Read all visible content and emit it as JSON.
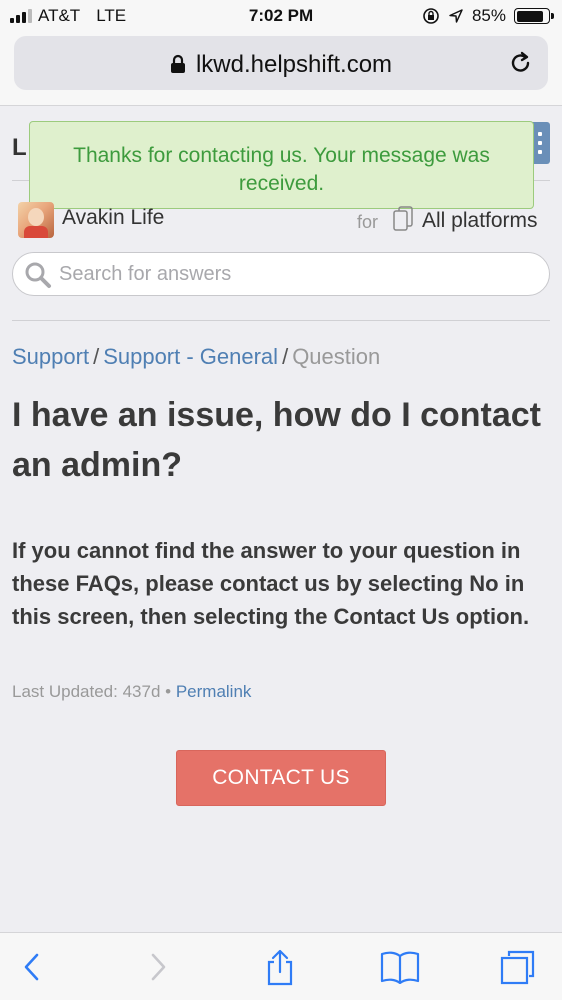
{
  "status_bar": {
    "carrier": "AT&T",
    "network": "LTE",
    "time": "7:02 PM",
    "battery_percent": "85%",
    "battery_level": 0.85
  },
  "browser": {
    "url": "lkwd.helpshift.com"
  },
  "site": {
    "logo_letter": "L"
  },
  "toast": {
    "message": "Thanks for contacting us. Your message was received."
  },
  "app": {
    "name": "Avakin Life",
    "for_label": "for",
    "platform": "All platforms"
  },
  "search": {
    "placeholder": "Search for answers"
  },
  "breadcrumb": {
    "items": [
      "Support",
      "Support - General"
    ],
    "separator": "/",
    "current": "Question"
  },
  "faq": {
    "title": "I have an issue, how do I contact an admin?",
    "body": "If you cannot find the answer to your question in these FAQs, please contact us by selecting No in this screen, then selecting the Contact Us option.",
    "last_updated_label": "Last Updated: 437d",
    "bullet": "•",
    "permalink": "Permalink"
  },
  "contact_button": {
    "label": "CONTACT US",
    "color": "#e57268"
  },
  "colors": {
    "link": "#4f7fb3",
    "toast_bg": "#dff0cd",
    "toast_text": "#3d9b3d",
    "ios_blue": "#2f7cf6"
  }
}
